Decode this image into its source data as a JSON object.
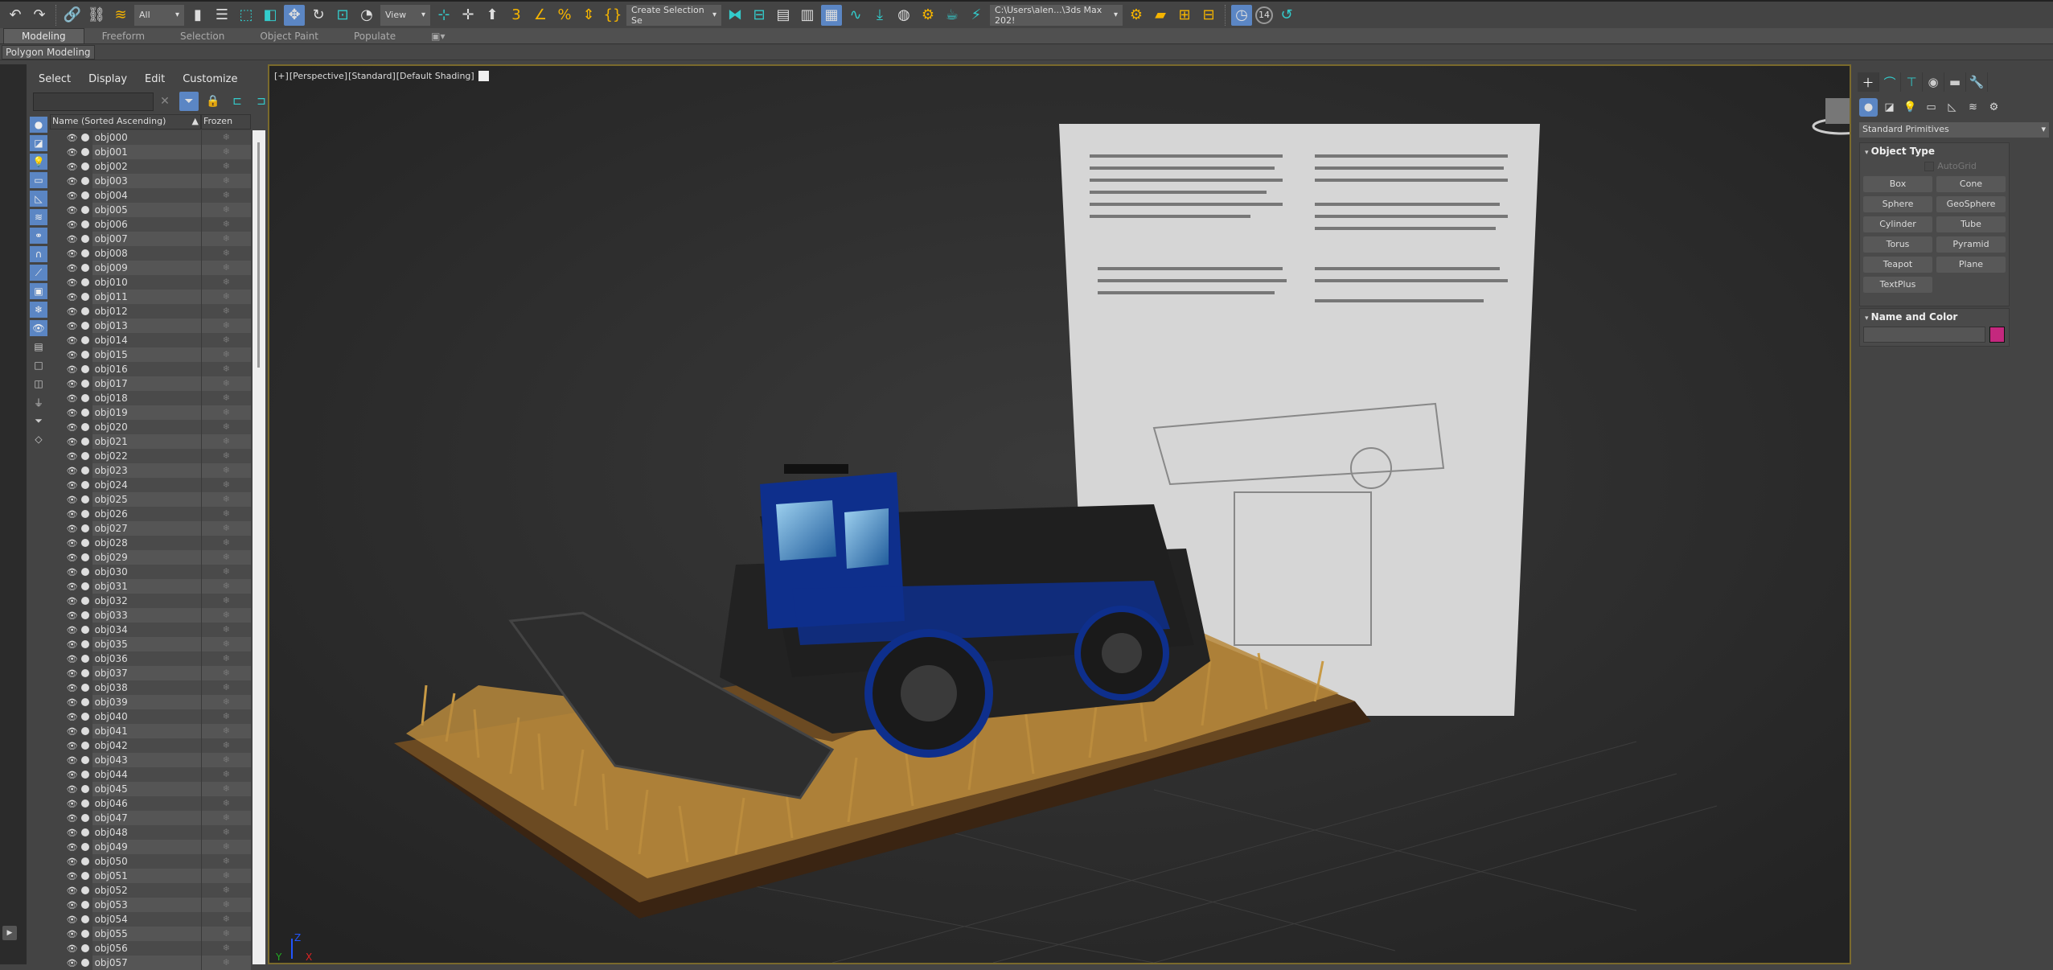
{
  "toolbar": {
    "selection_filter": "All",
    "reference_coord": "View",
    "named_selection": "Create Selection Se",
    "project_path": "C:\\Users\\alen...\\3ds Max 202!",
    "badge_number": "14"
  },
  "ribbon": {
    "tabs": [
      "Modeling",
      "Freeform",
      "Selection",
      "Object Paint",
      "Populate"
    ],
    "active_tab": "Modeling",
    "panel_label": "Polygon Modeling"
  },
  "explorer": {
    "menu": [
      "Select",
      "Display",
      "Edit",
      "Customize"
    ],
    "search_value": "",
    "col_name": "Name (Sorted Ascending)",
    "col_frozen": "Frozen",
    "rows": [
      "obj000",
      "obj001",
      "obj002",
      "obj003",
      "obj004",
      "obj005",
      "obj006",
      "obj007",
      "obj008",
      "obj009",
      "obj010",
      "obj011",
      "obj012",
      "obj013",
      "obj014",
      "obj015",
      "obj016",
      "obj017",
      "obj018",
      "obj019",
      "obj020",
      "obj021",
      "obj022",
      "obj023",
      "obj024",
      "obj025",
      "obj026",
      "obj027",
      "obj028",
      "obj029",
      "obj030",
      "obj031",
      "obj032",
      "obj033",
      "obj034",
      "obj035",
      "obj036",
      "obj037",
      "obj038",
      "obj039",
      "obj040",
      "obj041",
      "obj042",
      "obj043",
      "obj044",
      "obj045",
      "obj046",
      "obj047",
      "obj048",
      "obj049",
      "obj050",
      "obj051",
      "obj052",
      "obj053",
      "obj054",
      "obj055",
      "obj056",
      "obj057"
    ]
  },
  "viewport": {
    "label_parts": [
      "[+]",
      "[Perspective]",
      "[Standard]",
      "[Default Shading]"
    ],
    "axis_labels": {
      "x": "X",
      "y": "Y",
      "z": "Z"
    }
  },
  "command_panel": {
    "category_dropdown": "Standard Primitives",
    "object_type_title": "Object Type",
    "autogrid_label": "AutoGrid",
    "object_buttons": [
      "Box",
      "Cone",
      "Sphere",
      "GeoSphere",
      "Cylinder",
      "Tube",
      "Torus",
      "Pyramid",
      "Teapot",
      "Plane",
      "TextPlus"
    ],
    "name_color_title": "Name and Color",
    "name_value": "",
    "object_color": "#c4287e"
  },
  "colors": {
    "accent": "#5b86c4",
    "viewport_border": "#7a6a2c",
    "body_blue": "#0e2f8c",
    "wheat": "#c89a45",
    "base": "#3a2412"
  }
}
